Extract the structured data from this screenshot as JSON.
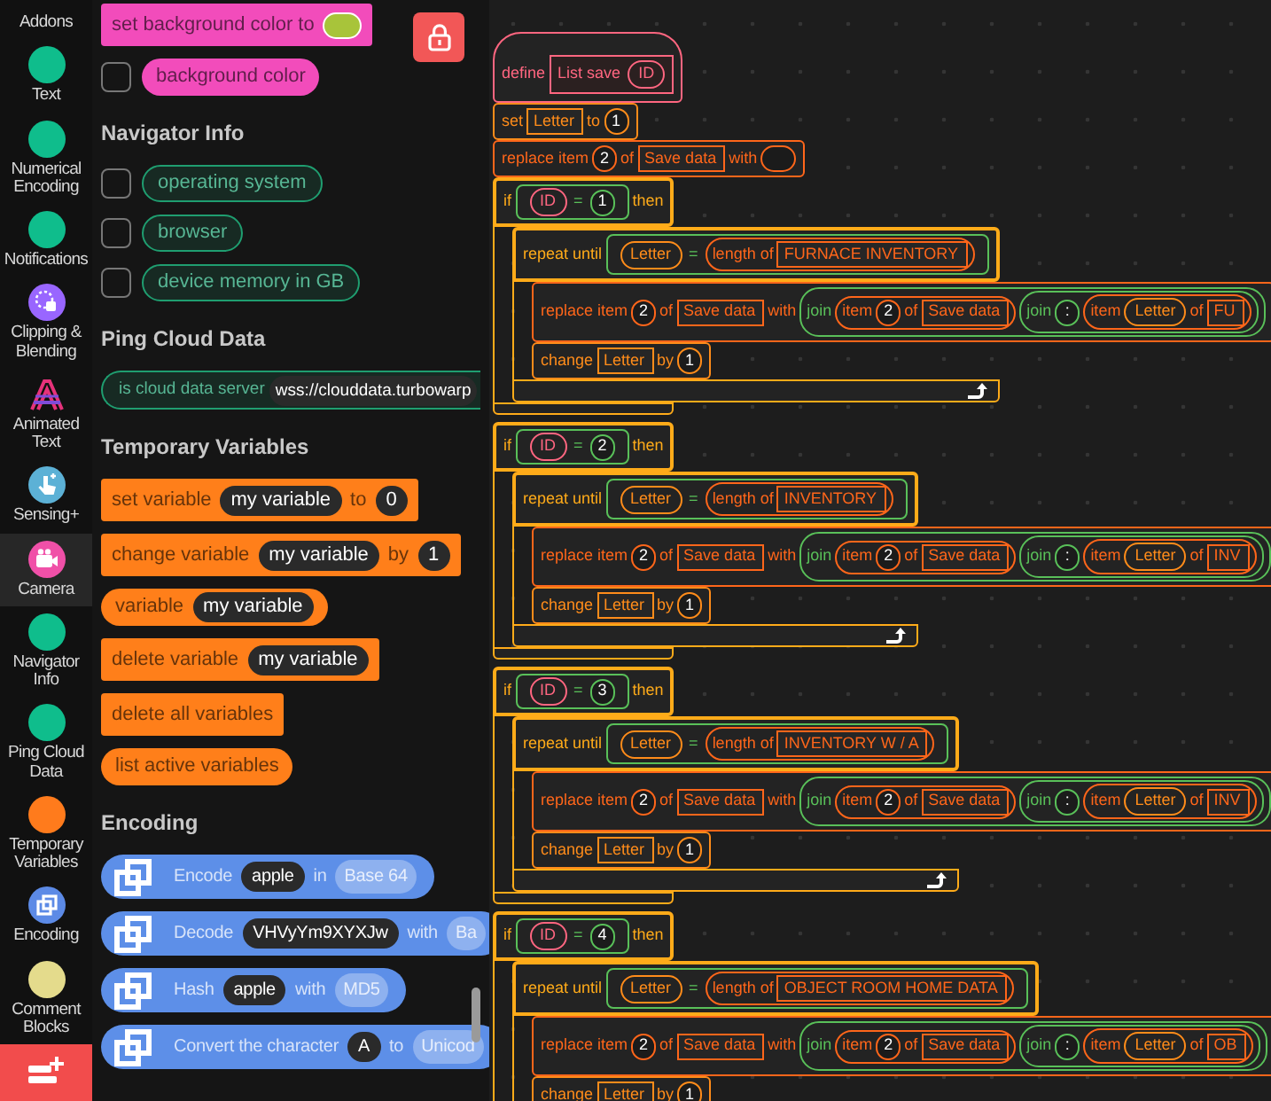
{
  "categories": [
    {
      "label": "Addons",
      "selected": false
    },
    {
      "label": "Text",
      "kind": "dot",
      "color": "#0fbd8c",
      "selected": false
    },
    {
      "label": "Numerical Encoding",
      "kind": "dot",
      "color": "#0fbd8c",
      "selected": false
    },
    {
      "label": "Notifications",
      "kind": "dot",
      "color": "#0fbd8c",
      "selected": false
    },
    {
      "label": "Clipping & Blending",
      "kind": "clip",
      "color": "#9966ff",
      "selected": false
    },
    {
      "label": "Animated Text",
      "kind": "animated",
      "color": "#e6327a",
      "selected": false
    },
    {
      "label": "Sensing+",
      "kind": "hand",
      "color": "#5cb1d6",
      "selected": false
    },
    {
      "label": "Camera",
      "kind": "camera",
      "color": "#f050a8",
      "selected": true
    },
    {
      "label": "Navigator Info",
      "kind": "dot",
      "color": "#0fbd8c",
      "selected": false
    },
    {
      "label": "Ping Cloud Data",
      "kind": "dot",
      "color": "#0fbd8c",
      "selected": false
    },
    {
      "label": "Temporary Variables",
      "kind": "dot",
      "color": "#ff7b1c",
      "selected": false
    },
    {
      "label": "Encoding",
      "kind": "encoding",
      "color": "#5c8ae6",
      "selected": false
    },
    {
      "label": "Comment Blocks",
      "kind": "dot",
      "color": "#e4db8c",
      "selected": false
    }
  ],
  "palette": [
    {
      "blocks": [
        {
          "kind": "stack",
          "color": "#f24cbb",
          "parts": [
            {
              "kind": "label",
              "text": "set background color to"
            },
            {
              "kind": "color",
              "color": "#a8c43a"
            }
          ]
        },
        {
          "kind": "reporter",
          "color": "#f24cbb",
          "checkbox": {
            "checked": false
          },
          "parts": [
            {
              "kind": "label",
              "text": "background color"
            }
          ]
        }
      ]
    },
    {
      "heading": "Navigator Info",
      "blocks": [
        {
          "kind": "outline_reporter",
          "color": "#1f9e70",
          "checkbox": {
            "checked": false
          },
          "parts": [
            {
              "kind": "label",
              "text": "operating system"
            }
          ]
        },
        {
          "kind": "outline_reporter",
          "color": "#1f9e70",
          "checkbox": {
            "checked": false
          },
          "parts": [
            {
              "kind": "label",
              "text": "browser"
            }
          ]
        },
        {
          "kind": "outline_reporter",
          "color": "#1f9e70",
          "checkbox": {
            "checked": false
          },
          "parts": [
            {
              "kind": "label",
              "text": "device memory in GB"
            }
          ]
        }
      ]
    },
    {
      "heading": "Ping Cloud Data",
      "blocks": [
        {
          "kind": "outline_boolean",
          "color": "#1f9e70",
          "parts": [
            {
              "kind": "label",
              "text": "is cloud data server"
            },
            {
              "kind": "text",
              "text": "wss://clouddata.turbowarp"
            }
          ]
        }
      ]
    },
    {
      "heading": "Temporary Variables",
      "blocks": [
        {
          "kind": "stack",
          "color": "#ff7f1a",
          "parts": [
            {
              "kind": "label",
              "text": "set variable"
            },
            {
              "kind": "text",
              "text": "my variable"
            },
            {
              "kind": "label",
              "text": "to"
            },
            {
              "kind": "text",
              "text": "0"
            }
          ]
        },
        {
          "kind": "stack",
          "color": "#ff7f1a",
          "parts": [
            {
              "kind": "label",
              "text": "change variable"
            },
            {
              "kind": "text",
              "text": "my variable"
            },
            {
              "kind": "label",
              "text": "by"
            },
            {
              "kind": "text",
              "text": "1"
            }
          ]
        },
        {
          "kind": "reporter",
          "color": "#ff7f1a",
          "parts": [
            {
              "kind": "label",
              "text": "variable"
            },
            {
              "kind": "text",
              "text": "my variable"
            }
          ]
        },
        {
          "kind": "stack",
          "color": "#ff7f1a",
          "parts": [
            {
              "kind": "label",
              "text": "delete variable"
            },
            {
              "kind": "text",
              "text": "my variable"
            }
          ]
        },
        {
          "kind": "stack",
          "color": "#ff7f1a",
          "parts": [
            {
              "kind": "label",
              "text": "delete all variables"
            }
          ]
        },
        {
          "kind": "reporter",
          "color": "#ff7f1a",
          "parts": [
            {
              "kind": "label",
              "text": "list active variables"
            }
          ]
        }
      ]
    },
    {
      "heading": "Encoding",
      "blocks": [
        {
          "kind": "icon_reporter",
          "color": "#5d8fe8",
          "parts": [
            {
              "kind": "label",
              "text": "Encode"
            },
            {
              "kind": "text",
              "text": "apple"
            },
            {
              "kind": "label",
              "text": "in"
            },
            {
              "kind": "menu",
              "text": "Base 64"
            }
          ]
        },
        {
          "kind": "icon_reporter",
          "color": "#5d8fe8",
          "parts": [
            {
              "kind": "label",
              "text": "Decode"
            },
            {
              "kind": "text",
              "text": "VHVyYm9XYXJw"
            },
            {
              "kind": "label",
              "text": "with"
            },
            {
              "kind": "menu",
              "text": "Ba"
            }
          ]
        },
        {
          "kind": "icon_reporter",
          "color": "#5d8fe8",
          "parts": [
            {
              "kind": "label",
              "text": "Hash"
            },
            {
              "kind": "text",
              "text": "apple"
            },
            {
              "kind": "label",
              "text": "with"
            },
            {
              "kind": "menu",
              "text": "MD5"
            }
          ]
        },
        {
          "kind": "icon_reporter",
          "color": "#5d8fe8",
          "parts": [
            {
              "kind": "label",
              "text": "Convert the character"
            },
            {
              "kind": "text",
              "text": "A"
            },
            {
              "kind": "label",
              "text": "to"
            },
            {
              "kind": "menu",
              "text": "Unicod"
            }
          ]
        }
      ]
    }
  ],
  "script": {
    "hat": {
      "kind": "define",
      "color": "#ff6680",
      "parts": [
        {
          "kind": "label",
          "text": "define"
        },
        {
          "kind": "proto",
          "parts": [
            {
              "kind": "label",
              "text": "List save"
            },
            {
              "kind": "arg",
              "text": "ID"
            }
          ]
        }
      ]
    },
    "blocks": [
      {
        "kind": "stack",
        "color": "#ff8c1a",
        "parts": [
          {
            "kind": "label",
            "text": "set"
          },
          {
            "kind": "field",
            "text": "Letter"
          },
          {
            "kind": "label",
            "text": "to"
          },
          {
            "kind": "number",
            "text": "1"
          }
        ]
      },
      {
        "kind": "stack",
        "color": "#ff661a",
        "parts": [
          {
            "kind": "label",
            "text": "replace item"
          },
          {
            "kind": "number",
            "text": "2"
          },
          {
            "kind": "label",
            "text": "of"
          },
          {
            "kind": "field",
            "text": "Save data"
          },
          {
            "kind": "label",
            "text": "with"
          },
          {
            "kind": "empty"
          }
        ]
      },
      {
        "kind": "if",
        "color": "#ffab19",
        "parts": [
          {
            "kind": "label",
            "text": "if"
          },
          {
            "kind": "bool",
            "color": "#59c059",
            "parts": [
              {
                "kind": "arg",
                "text": "ID"
              },
              {
                "kind": "label",
                "text": "="
              },
              {
                "kind": "number",
                "text": "1"
              }
            ]
          },
          {
            "kind": "label",
            "text": "then"
          }
        ],
        "children": [
          {
            "kind": "repeat",
            "color": "#ffab19",
            "parts": [
              {
                "kind": "label",
                "text": "repeat until"
              },
              {
                "kind": "bool",
                "color": "#59c059",
                "parts": [
                  {
                    "kind": "var",
                    "text": "Letter"
                  },
                  {
                    "kind": "label",
                    "text": "="
                  },
                  {
                    "kind": "reporter",
                    "color": "#ff661a",
                    "parts": [
                      {
                        "kind": "label",
                        "text": "length of"
                      },
                      {
                        "kind": "field",
                        "text": "FURNACE INVENTORY"
                      }
                    ]
                  }
                ]
              }
            ],
            "children": [
              {
                "kind": "stack",
                "color": "#ff661a",
                "parts": [
                  {
                    "kind": "label",
                    "text": "replace item"
                  },
                  {
                    "kind": "number",
                    "text": "2"
                  },
                  {
                    "kind": "label",
                    "text": "of"
                  },
                  {
                    "kind": "field",
                    "text": "Save data"
                  },
                  {
                    "kind": "label",
                    "text": "with"
                  },
                  {
                    "kind": "reporter",
                    "color": "#59c059",
                    "parts": [
                      {
                        "kind": "label",
                        "text": "join"
                      },
                      {
                        "kind": "reporter",
                        "color": "#ff661a",
                        "parts": [
                          {
                            "kind": "label",
                            "text": "item"
                          },
                          {
                            "kind": "number",
                            "text": "2"
                          },
                          {
                            "kind": "label",
                            "text": "of"
                          },
                          {
                            "kind": "field",
                            "text": "Save data"
                          }
                        ]
                      },
                      {
                        "kind": "reporter",
                        "color": "#59c059",
                        "parts": [
                          {
                            "kind": "label",
                            "text": "join"
                          },
                          {
                            "kind": "number",
                            "text": ":"
                          },
                          {
                            "kind": "reporter",
                            "color": "#ff661a",
                            "parts": [
                              {
                                "kind": "label",
                                "text": "item"
                              },
                              {
                                "kind": "var",
                                "text": "Letter"
                              },
                              {
                                "kind": "label",
                                "text": "of"
                              },
                              {
                                "kind": "field",
                                "text": "FU"
                              }
                            ]
                          }
                        ]
                      }
                    ]
                  }
                ]
              },
              {
                "kind": "stack",
                "color": "#ff8c1a",
                "parts": [
                  {
                    "kind": "label",
                    "text": "change"
                  },
                  {
                    "kind": "field",
                    "text": "Letter"
                  },
                  {
                    "kind": "label",
                    "text": "by"
                  },
                  {
                    "kind": "number",
                    "text": "1"
                  }
                ]
              }
            ]
          }
        ]
      },
      {
        "kind": "if",
        "color": "#ffab19",
        "parts": [
          {
            "kind": "label",
            "text": "if"
          },
          {
            "kind": "bool",
            "color": "#59c059",
            "parts": [
              {
                "kind": "arg",
                "text": "ID"
              },
              {
                "kind": "label",
                "text": "="
              },
              {
                "kind": "number",
                "text": "2"
              }
            ]
          },
          {
            "kind": "label",
            "text": "then"
          }
        ],
        "children": [
          {
            "kind": "repeat",
            "color": "#ffab19",
            "parts": [
              {
                "kind": "label",
                "text": "repeat until"
              },
              {
                "kind": "bool",
                "color": "#59c059",
                "parts": [
                  {
                    "kind": "var",
                    "text": "Letter"
                  },
                  {
                    "kind": "label",
                    "text": "="
                  },
                  {
                    "kind": "reporter",
                    "color": "#ff661a",
                    "parts": [
                      {
                        "kind": "label",
                        "text": "length of"
                      },
                      {
                        "kind": "field",
                        "text": "INVENTORY"
                      }
                    ]
                  }
                ]
              }
            ],
            "children": [
              {
                "kind": "stack",
                "color": "#ff661a",
                "parts": [
                  {
                    "kind": "label",
                    "text": "replace item"
                  },
                  {
                    "kind": "number",
                    "text": "2"
                  },
                  {
                    "kind": "label",
                    "text": "of"
                  },
                  {
                    "kind": "field",
                    "text": "Save data"
                  },
                  {
                    "kind": "label",
                    "text": "with"
                  },
                  {
                    "kind": "reporter",
                    "color": "#59c059",
                    "parts": [
                      {
                        "kind": "label",
                        "text": "join"
                      },
                      {
                        "kind": "reporter",
                        "color": "#ff661a",
                        "parts": [
                          {
                            "kind": "label",
                            "text": "item"
                          },
                          {
                            "kind": "number",
                            "text": "2"
                          },
                          {
                            "kind": "label",
                            "text": "of"
                          },
                          {
                            "kind": "field",
                            "text": "Save data"
                          }
                        ]
                      },
                      {
                        "kind": "reporter",
                        "color": "#59c059",
                        "parts": [
                          {
                            "kind": "label",
                            "text": "join"
                          },
                          {
                            "kind": "number",
                            "text": ":"
                          },
                          {
                            "kind": "reporter",
                            "color": "#ff661a",
                            "parts": [
                              {
                                "kind": "label",
                                "text": "item"
                              },
                              {
                                "kind": "var",
                                "text": "Letter"
                              },
                              {
                                "kind": "label",
                                "text": "of"
                              },
                              {
                                "kind": "field",
                                "text": "INV"
                              }
                            ]
                          }
                        ]
                      }
                    ]
                  }
                ]
              },
              {
                "kind": "stack",
                "color": "#ff8c1a",
                "parts": [
                  {
                    "kind": "label",
                    "text": "change"
                  },
                  {
                    "kind": "field",
                    "text": "Letter"
                  },
                  {
                    "kind": "label",
                    "text": "by"
                  },
                  {
                    "kind": "number",
                    "text": "1"
                  }
                ]
              }
            ]
          }
        ]
      },
      {
        "kind": "if",
        "color": "#ffab19",
        "parts": [
          {
            "kind": "label",
            "text": "if"
          },
          {
            "kind": "bool",
            "color": "#59c059",
            "parts": [
              {
                "kind": "arg",
                "text": "ID"
              },
              {
                "kind": "label",
                "text": "="
              },
              {
                "kind": "number",
                "text": "3"
              }
            ]
          },
          {
            "kind": "label",
            "text": "then"
          }
        ],
        "children": [
          {
            "kind": "repeat",
            "color": "#ffab19",
            "parts": [
              {
                "kind": "label",
                "text": "repeat until"
              },
              {
                "kind": "bool",
                "color": "#59c059",
                "parts": [
                  {
                    "kind": "var",
                    "text": "Letter"
                  },
                  {
                    "kind": "label",
                    "text": "="
                  },
                  {
                    "kind": "reporter",
                    "color": "#ff661a",
                    "parts": [
                      {
                        "kind": "label",
                        "text": "length of"
                      },
                      {
                        "kind": "field",
                        "text": "INVENTORY W / A"
                      }
                    ]
                  }
                ]
              }
            ],
            "children": [
              {
                "kind": "stack",
                "color": "#ff661a",
                "parts": [
                  {
                    "kind": "label",
                    "text": "replace item"
                  },
                  {
                    "kind": "number",
                    "text": "2"
                  },
                  {
                    "kind": "label",
                    "text": "of"
                  },
                  {
                    "kind": "field",
                    "text": "Save data"
                  },
                  {
                    "kind": "label",
                    "text": "with"
                  },
                  {
                    "kind": "reporter",
                    "color": "#59c059",
                    "parts": [
                      {
                        "kind": "label",
                        "text": "join"
                      },
                      {
                        "kind": "reporter",
                        "color": "#ff661a",
                        "parts": [
                          {
                            "kind": "label",
                            "text": "item"
                          },
                          {
                            "kind": "number",
                            "text": "2"
                          },
                          {
                            "kind": "label",
                            "text": "of"
                          },
                          {
                            "kind": "field",
                            "text": "Save data"
                          }
                        ]
                      },
                      {
                        "kind": "reporter",
                        "color": "#59c059",
                        "parts": [
                          {
                            "kind": "label",
                            "text": "join"
                          },
                          {
                            "kind": "number",
                            "text": ":"
                          },
                          {
                            "kind": "reporter",
                            "color": "#ff661a",
                            "parts": [
                              {
                                "kind": "label",
                                "text": "item"
                              },
                              {
                                "kind": "var",
                                "text": "Letter"
                              },
                              {
                                "kind": "label",
                                "text": "of"
                              },
                              {
                                "kind": "field",
                                "text": "INV"
                              }
                            ]
                          }
                        ]
                      }
                    ]
                  }
                ]
              },
              {
                "kind": "stack",
                "color": "#ff8c1a",
                "parts": [
                  {
                    "kind": "label",
                    "text": "change"
                  },
                  {
                    "kind": "field",
                    "text": "Letter"
                  },
                  {
                    "kind": "label",
                    "text": "by"
                  },
                  {
                    "kind": "number",
                    "text": "1"
                  }
                ]
              }
            ]
          }
        ]
      },
      {
        "kind": "if",
        "color": "#ffab19",
        "parts": [
          {
            "kind": "label",
            "text": "if"
          },
          {
            "kind": "bool",
            "color": "#59c059",
            "parts": [
              {
                "kind": "arg",
                "text": "ID"
              },
              {
                "kind": "label",
                "text": "="
              },
              {
                "kind": "number",
                "text": "4"
              }
            ]
          },
          {
            "kind": "label",
            "text": "then"
          }
        ],
        "children": [
          {
            "kind": "repeat",
            "color": "#ffab19",
            "parts": [
              {
                "kind": "label",
                "text": "repeat until"
              },
              {
                "kind": "bool",
                "color": "#59c059",
                "parts": [
                  {
                    "kind": "var",
                    "text": "Letter"
                  },
                  {
                    "kind": "label",
                    "text": "="
                  },
                  {
                    "kind": "reporter",
                    "color": "#ff661a",
                    "parts": [
                      {
                        "kind": "label",
                        "text": "length of"
                      },
                      {
                        "kind": "field",
                        "text": "OBJECT ROOM HOME DATA"
                      }
                    ]
                  }
                ]
              }
            ],
            "children": [
              {
                "kind": "stack",
                "color": "#ff661a",
                "parts": [
                  {
                    "kind": "label",
                    "text": "replace item"
                  },
                  {
                    "kind": "number",
                    "text": "2"
                  },
                  {
                    "kind": "label",
                    "text": "of"
                  },
                  {
                    "kind": "field",
                    "text": "Save data"
                  },
                  {
                    "kind": "label",
                    "text": "with"
                  },
                  {
                    "kind": "reporter",
                    "color": "#59c059",
                    "parts": [
                      {
                        "kind": "label",
                        "text": "join"
                      },
                      {
                        "kind": "reporter",
                        "color": "#ff661a",
                        "parts": [
                          {
                            "kind": "label",
                            "text": "item"
                          },
                          {
                            "kind": "number",
                            "text": "2"
                          },
                          {
                            "kind": "label",
                            "text": "of"
                          },
                          {
                            "kind": "field",
                            "text": "Save data"
                          }
                        ]
                      },
                      {
                        "kind": "reporter",
                        "color": "#59c059",
                        "parts": [
                          {
                            "kind": "label",
                            "text": "join"
                          },
                          {
                            "kind": "number",
                            "text": ":"
                          },
                          {
                            "kind": "reporter",
                            "color": "#ff661a",
                            "parts": [
                              {
                                "kind": "label",
                                "text": "item"
                              },
                              {
                                "kind": "var",
                                "text": "Letter"
                              },
                              {
                                "kind": "label",
                                "text": "of"
                              },
                              {
                                "kind": "field",
                                "text": "OB"
                              }
                            ]
                          }
                        ]
                      }
                    ]
                  }
                ]
              },
              {
                "kind": "stack",
                "color": "#ff8c1a",
                "parts": [
                  {
                    "kind": "label",
                    "text": "change"
                  },
                  {
                    "kind": "field",
                    "text": "Letter"
                  },
                  {
                    "kind": "label",
                    "text": "by"
                  },
                  {
                    "kind": "number",
                    "text": "1"
                  }
                ]
              }
            ]
          }
        ]
      }
    ]
  }
}
